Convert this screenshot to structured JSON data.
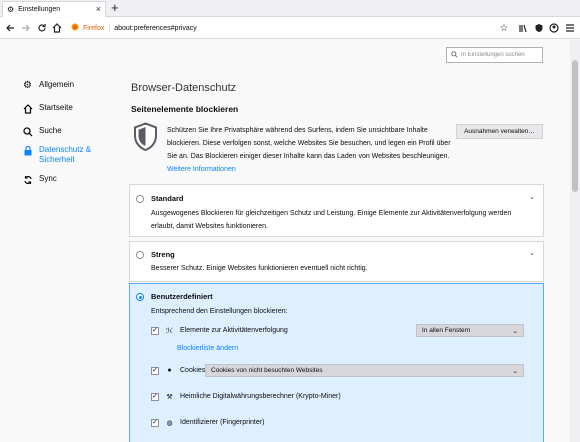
{
  "tab": {
    "title": "Einstellungen",
    "close": "×",
    "new_tab": "+"
  },
  "urlbar": {
    "brand": "Firefox",
    "url": "about:preferences#privacy"
  },
  "sidebar": {
    "items": [
      {
        "label": "Allgemein",
        "icon": "gear-icon"
      },
      {
        "label": "Startseite",
        "icon": "home-icon"
      },
      {
        "label": "Suche",
        "icon": "search-icon"
      },
      {
        "label": "Datenschutz &\nSicherheit",
        "icon": "lock-icon"
      },
      {
        "label": "Sync",
        "icon": "sync-icon"
      }
    ]
  },
  "search": {
    "placeholder": "In Einstellungen suchen"
  },
  "page": {
    "title": "Browser-Datenschutz",
    "section": "Seitenelemente blockieren",
    "intro": "Schützen Sie Ihre Privatsphäre während des Surfens, indem Sie unsichtbare Inhalte blockieren. Diese verfolgen sonst, welche Websites Sie besuchen, und legen ein Profil über Sie an. Das Blockieren einiger dieser Inhalte kann das Laden von Websites beschleunigen. ",
    "intro_link": "Weitere Informationen",
    "exceptions_button": "Ausnahmen verwalten…"
  },
  "options": {
    "standard": {
      "title": "Standard",
      "desc": "Ausgewogenes Blockieren für gleichzeitigen Schutz und Leistung. Einige Elemente zur Aktivitätenverfolgung werden erlaubt, damit Websites funktionieren."
    },
    "strict": {
      "title": "Streng",
      "desc": "Besserer Schutz. Einige Websites funktionieren eventuell nicht richtig."
    },
    "custom": {
      "title": "Benutzerdefiniert",
      "desc": "Entsprechend den Einstellungen blockieren:",
      "trackers_label": "Elemente zur Aktivitätenverfolgung",
      "trackers_select": "In allen Fenstern",
      "blocklist_link": "Blockierliste ändern",
      "cookies_label": "Cookies",
      "cookies_select": "Cookies von nicht besuchten Websites",
      "cryptominers_label": "Heimliche Digitalwährungsberechner (Krypto-Miner)",
      "fingerprinters_label": "Identifizierer (Fingerprinter)"
    }
  }
}
